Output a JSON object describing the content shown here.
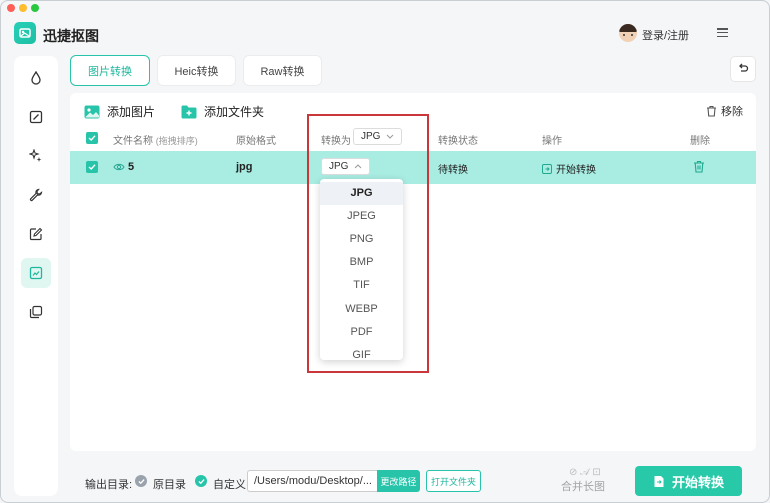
{
  "app": {
    "title": "迅捷抠图"
  },
  "header": {
    "login_label": "登录/注册"
  },
  "tabs": [
    {
      "label": "图片转换",
      "active": true
    },
    {
      "label": "Heic转换",
      "active": false
    },
    {
      "label": "Raw转换",
      "active": false
    }
  ],
  "toolbar": {
    "add_image": "添加图片",
    "add_folder": "添加文件夹",
    "remove": "移除"
  },
  "table": {
    "headers": {
      "filename": "文件名称",
      "filename_hint": "(拖拽排序)",
      "original_format": "原始格式",
      "convert_to": "转换为",
      "convert_to_value": "JPG",
      "status": "转换状态",
      "action": "操作",
      "delete": "删除"
    },
    "rows": [
      {
        "name": "5",
        "original_format": "jpg",
        "target_format": "JPG",
        "status": "待转换",
        "action": "开始转换"
      }
    ]
  },
  "format_dropdown": {
    "options": [
      "JPG",
      "JPEG",
      "PNG",
      "BMP",
      "TIF",
      "WEBP",
      "PDF",
      "GIF"
    ],
    "selected": "JPG"
  },
  "footer": {
    "output_label": "输出目录:",
    "option_original": "原目录",
    "option_custom": "自定义",
    "path_value": "/Users/modu/Desktop/...",
    "change_path": "更改路径",
    "open_folder": "打开文件夹",
    "watermark": "合并长图",
    "start_button": "开始转换"
  },
  "colors": {
    "accent": "#28c4aa",
    "row_highlight": "#a8ece2",
    "annotation_red": "#c9373a"
  }
}
